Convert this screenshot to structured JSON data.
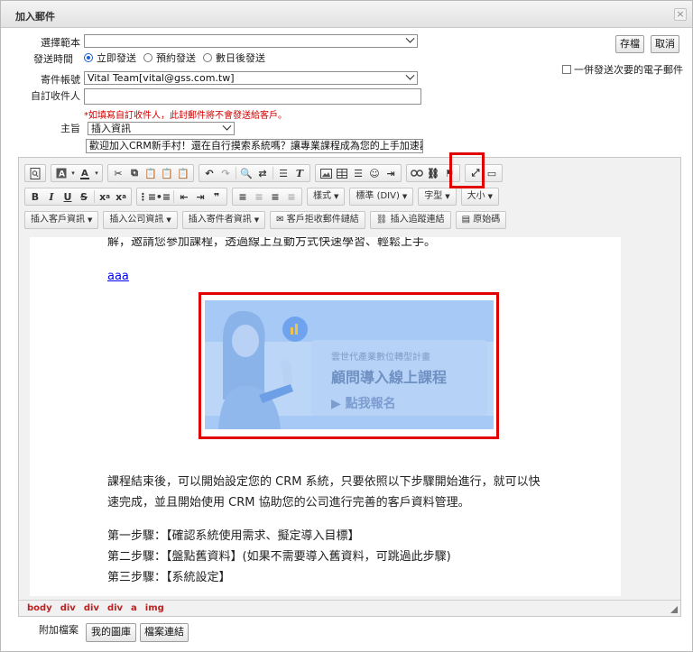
{
  "dialog": {
    "title": "加入郵件",
    "close_glyph": "×"
  },
  "form": {
    "template_label": "選擇範本",
    "send_time_label": "發送時間",
    "send_options": [
      "立即發送",
      "預約發送",
      "數日後發送"
    ],
    "selected_send_option": 0,
    "sender_label": "寄件帳號",
    "sender_value": "Vital Team[vital@gss.com.tw]",
    "custom_recipient_label": "自訂收件人",
    "custom_recipient_value": "",
    "note": "*如填寫自訂收件人，此封郵件將不會發送給客戶。",
    "subject_label": "主旨",
    "subject_insert_value": "插入資訊",
    "subject_value": "歡迎加入CRM新手村！還在自行摸索系統嗎？讓專業課程成為您的上手加速器，i"
  },
  "actions": {
    "save_label": "存檔",
    "cancel_label": "取消",
    "send_next_label": "一併發送次要的電子郵件"
  },
  "toolbar": {
    "style_label": "樣式",
    "format_label": "標準 (DIV)",
    "font_label": "字型",
    "size_label": "大小",
    "insert_customer_label": "插入客戶資訊",
    "insert_company_label": "插入公司資訊",
    "insert_sender_label": "插入寄件者資訊",
    "unsubscribe_link_label": "客戶拒收郵件鏈結",
    "tracking_link_label": "插入追蹤連結",
    "source_label": "原始碼"
  },
  "content": {
    "line_top": "解，邀請您參加課程，透過線上互動方式快速學習、輕鬆上手。",
    "link_text": "aaa",
    "banner_line1": "雲世代產業數位轉型計畫",
    "banner_line2": "顧問導入線上課程",
    "banner_line3": "▶ 點我報名",
    "para1_line1": "課程結束後，可以開始設定您的 CRM 系統，只要依照以下步驟開始進行，就可以快",
    "para1_line2": "速完成，並且開始使用 CRM 協助您的公司進行完善的客戶資料管理。",
    "step1": "第一步驟：【確認系統使用需求、擬定導入目標】",
    "step2": "第二步驟：【盤點舊資料】(如果不需要導入舊資料，可跳過此步驟)",
    "step3": "第三步驟：【系統設定】"
  },
  "pathbar": [
    "body",
    "div",
    "div",
    "div",
    "a",
    "img"
  ],
  "attachments": {
    "label": "附加檔案",
    "my_gallery_label": "我的圖庫",
    "file_link_label": "檔案連結"
  },
  "colors": {
    "highlight": "#e00000",
    "banner_bg": "#a7c9f5",
    "note": "#d10000"
  }
}
